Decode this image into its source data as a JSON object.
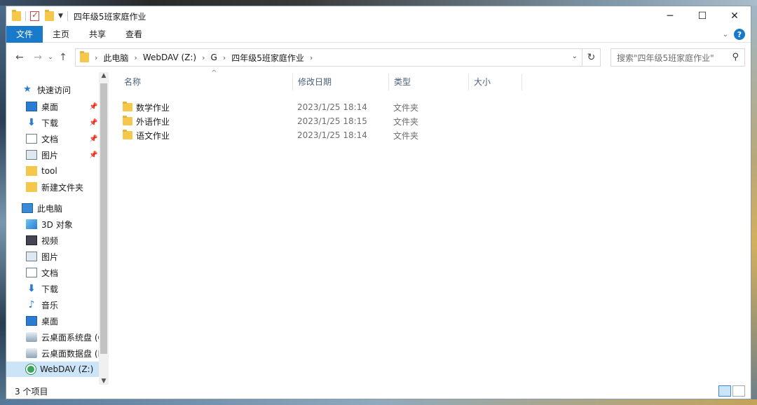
{
  "window": {
    "title": "四年级5班家庭作业",
    "controls": {
      "minimize": "─",
      "maximize": "☐",
      "close": "✕"
    }
  },
  "ribbon": {
    "tabs": [
      "文件",
      "主页",
      "共享",
      "查看"
    ],
    "collapse_icon": "chevron-down-icon",
    "help_icon": "?"
  },
  "nav": {
    "back": "←",
    "forward": "→",
    "recent": "⌄",
    "up": "↑",
    "breadcrumb": [
      "此电脑",
      "WebDAV (Z:)",
      "G",
      "四年级5班家庭作业"
    ],
    "refresh": "↻",
    "search_placeholder": "搜索\"四年级5班家庭作业\""
  },
  "sidebar": {
    "quick_access": {
      "label": "快速访问",
      "items": [
        {
          "label": "桌面",
          "icon": "desktop-icon",
          "pinned": true
        },
        {
          "label": "下载",
          "icon": "download-icon",
          "pinned": true
        },
        {
          "label": "文档",
          "icon": "document-icon",
          "pinned": true
        },
        {
          "label": "图片",
          "icon": "picture-icon",
          "pinned": true
        },
        {
          "label": "tool",
          "icon": "folder-icon",
          "pinned": false
        },
        {
          "label": "新建文件夹",
          "icon": "folder-icon",
          "pinned": false
        }
      ]
    },
    "this_pc": {
      "label": "此电脑",
      "items": [
        {
          "label": "3D 对象",
          "icon": "3d-objects-icon"
        },
        {
          "label": "视频",
          "icon": "video-icon"
        },
        {
          "label": "图片",
          "icon": "picture-icon"
        },
        {
          "label": "文档",
          "icon": "document-icon"
        },
        {
          "label": "下载",
          "icon": "download-icon"
        },
        {
          "label": "音乐",
          "icon": "music-icon"
        },
        {
          "label": "桌面",
          "icon": "desktop-icon"
        },
        {
          "label": "云桌面系统盘 (C",
          "icon": "drive-icon"
        },
        {
          "label": "云桌面数据盘 (D",
          "icon": "drive-icon"
        },
        {
          "label": "WebDAV (Z:)",
          "icon": "webdav-drive-icon",
          "selected": true
        }
      ]
    }
  },
  "list": {
    "columns": [
      "名称",
      "修改日期",
      "类型",
      "大小"
    ],
    "rows": [
      {
        "name": "数学作业",
        "date": "2023/1/25 18:14",
        "type": "文件夹",
        "size": ""
      },
      {
        "name": "外语作业",
        "date": "2023/1/25 18:15",
        "type": "文件夹",
        "size": ""
      },
      {
        "name": "语文作业",
        "date": "2023/1/25 18:14",
        "type": "文件夹",
        "size": ""
      }
    ]
  },
  "status": {
    "count": "3 个项目"
  },
  "colors": {
    "accent": "#1979ca",
    "selection": "#cce4f7",
    "folder": "#f5c84c"
  }
}
